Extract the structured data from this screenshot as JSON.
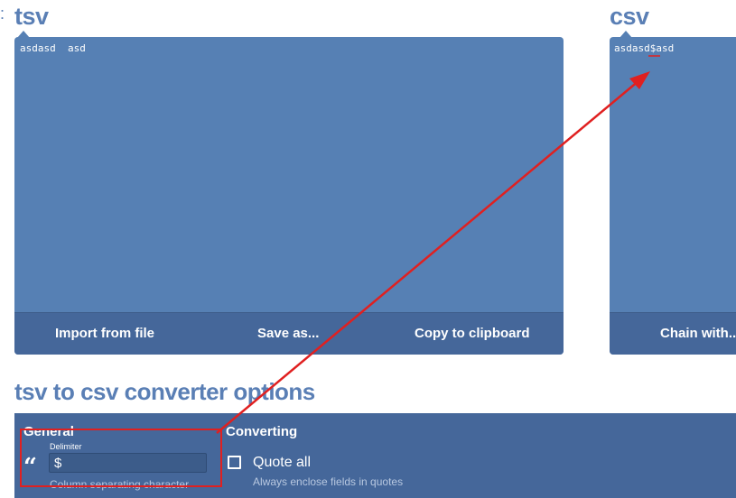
{
  "tsv_section": {
    "title": "tsv",
    "content": "asdasd\tasd",
    "buttons": {
      "import": "Import from file",
      "save": "Save as...",
      "copy": "Copy to clipboard"
    }
  },
  "csv_section": {
    "title": "csv",
    "content": "asdasd$asd",
    "buttons": {
      "chain": "Chain with..."
    }
  },
  "options": {
    "title": "tsv to csv converter options",
    "general": {
      "heading": "General",
      "delimiter_label": "Delimiter",
      "delimiter_value": "$",
      "delimiter_hint": "Column separating character"
    },
    "converting": {
      "heading": "Converting",
      "quote_all_label": "Quote all",
      "quote_all_hint": "Always enclose fields in quotes",
      "quote_all_checked": false
    }
  },
  "icons": {
    "quote": "“"
  },
  "annotation": {
    "color": "#e02020"
  }
}
